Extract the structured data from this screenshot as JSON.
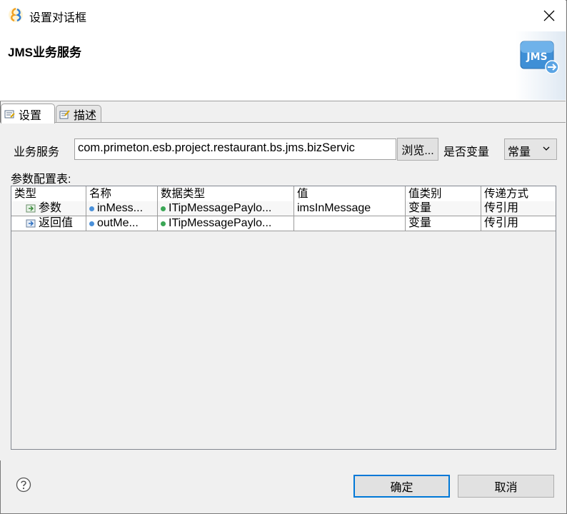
{
  "window": {
    "title": "设置对话框",
    "icon": "app-swirl-icon"
  },
  "header": {
    "title": "JMS业务服务",
    "banner_icon_text": "JMS"
  },
  "tabs": [
    {
      "label": "设置",
      "icon": "settings-tab-icon",
      "active": true
    },
    {
      "label": "描述",
      "icon": "description-tab-icon",
      "active": false
    }
  ],
  "form": {
    "service_label": "业务服务",
    "service_value": "com.primeton.esb.project.restaurant.bs.jms.bizServic",
    "browse_label": "浏览...",
    "variable_label": "是否变量",
    "variable_value": "常量"
  },
  "params": {
    "label": "参数配置表:",
    "columns": [
      "类型",
      "名称",
      "数据类型",
      "值",
      "值类别",
      "传递方式"
    ],
    "rows": [
      {
        "type": "参数",
        "name": "inMess...",
        "data_type": "ITipMessagePaylo...",
        "value": "imsInMessage",
        "value_kind": "变量",
        "pass_mode": "传引用"
      },
      {
        "type": "返回值",
        "name": "outMe...",
        "data_type": "ITipMessagePaylo...",
        "value": "",
        "value_kind": "变量",
        "pass_mode": "传引用"
      }
    ]
  },
  "buttons": {
    "ok": "确定",
    "cancel": "取消"
  },
  "colors": {
    "accent": "#0078d7",
    "dot_blue": "#4a90d9",
    "dot_green": "#3aa655"
  }
}
